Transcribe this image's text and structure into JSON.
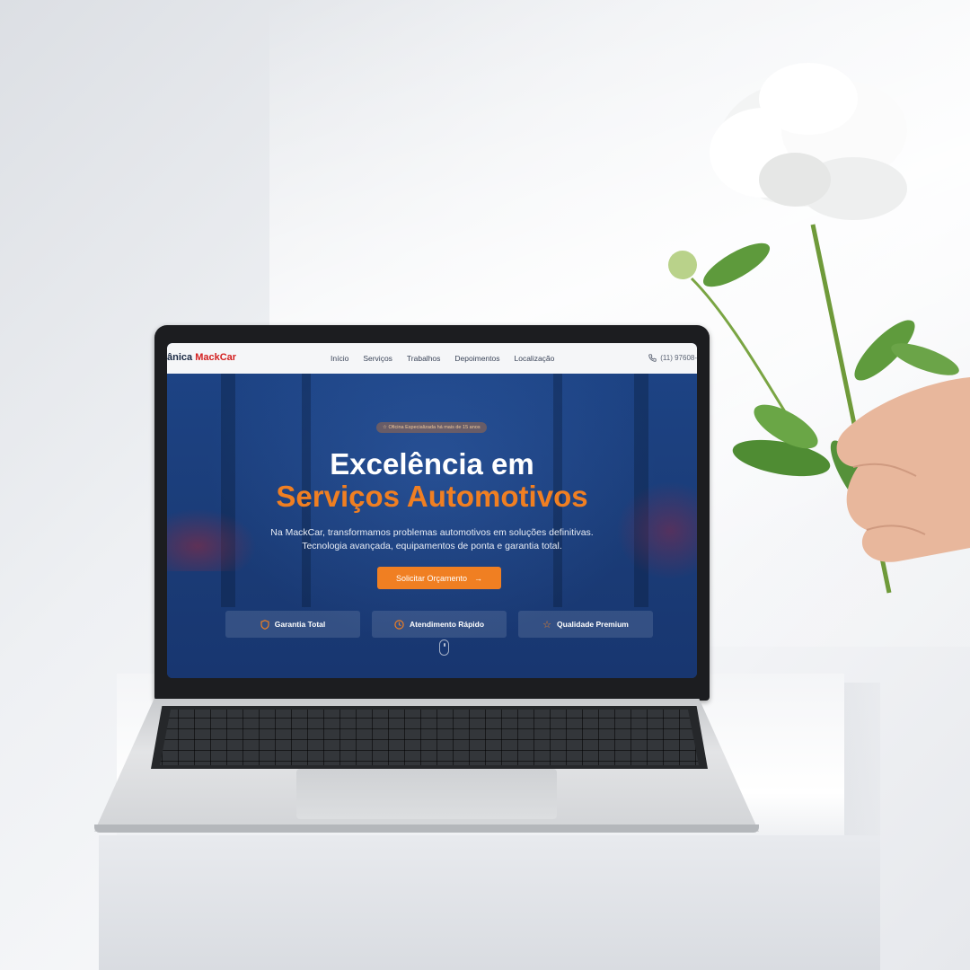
{
  "nav": {
    "brand_prefix": "ânica ",
    "brand_name": "MackCar",
    "links": [
      "Início",
      "Serviços",
      "Trabalhos",
      "Depoimentos",
      "Localização"
    ],
    "phone_icon": "phone-icon",
    "phone": "(11) 97608-"
  },
  "hero": {
    "badge_icon": "star-icon",
    "badge": "Oficina Especializada há mais de 15 anos",
    "title_line1": "Excelência em",
    "title_line2": "Serviços Automotivos",
    "subtitle_line1": "Na MackCar, transformamos problemas automotivos em soluções definitivas.",
    "subtitle_line2": "Tecnologia avançada, equipamentos de ponta e garantia total.",
    "cta_label": "Solicitar Orçamento",
    "cta_icon": "arrow-right-icon",
    "features": [
      {
        "icon": "shield-icon",
        "label": "Garantia Total"
      },
      {
        "icon": "clock-icon",
        "label": "Atendimento Rápido"
      },
      {
        "icon": "star-icon",
        "label": "Qualidade Premium"
      }
    ]
  },
  "colors": {
    "accent": "#f07f22",
    "brand_red": "#d32020",
    "hero_blue": "#1b3f7e"
  }
}
